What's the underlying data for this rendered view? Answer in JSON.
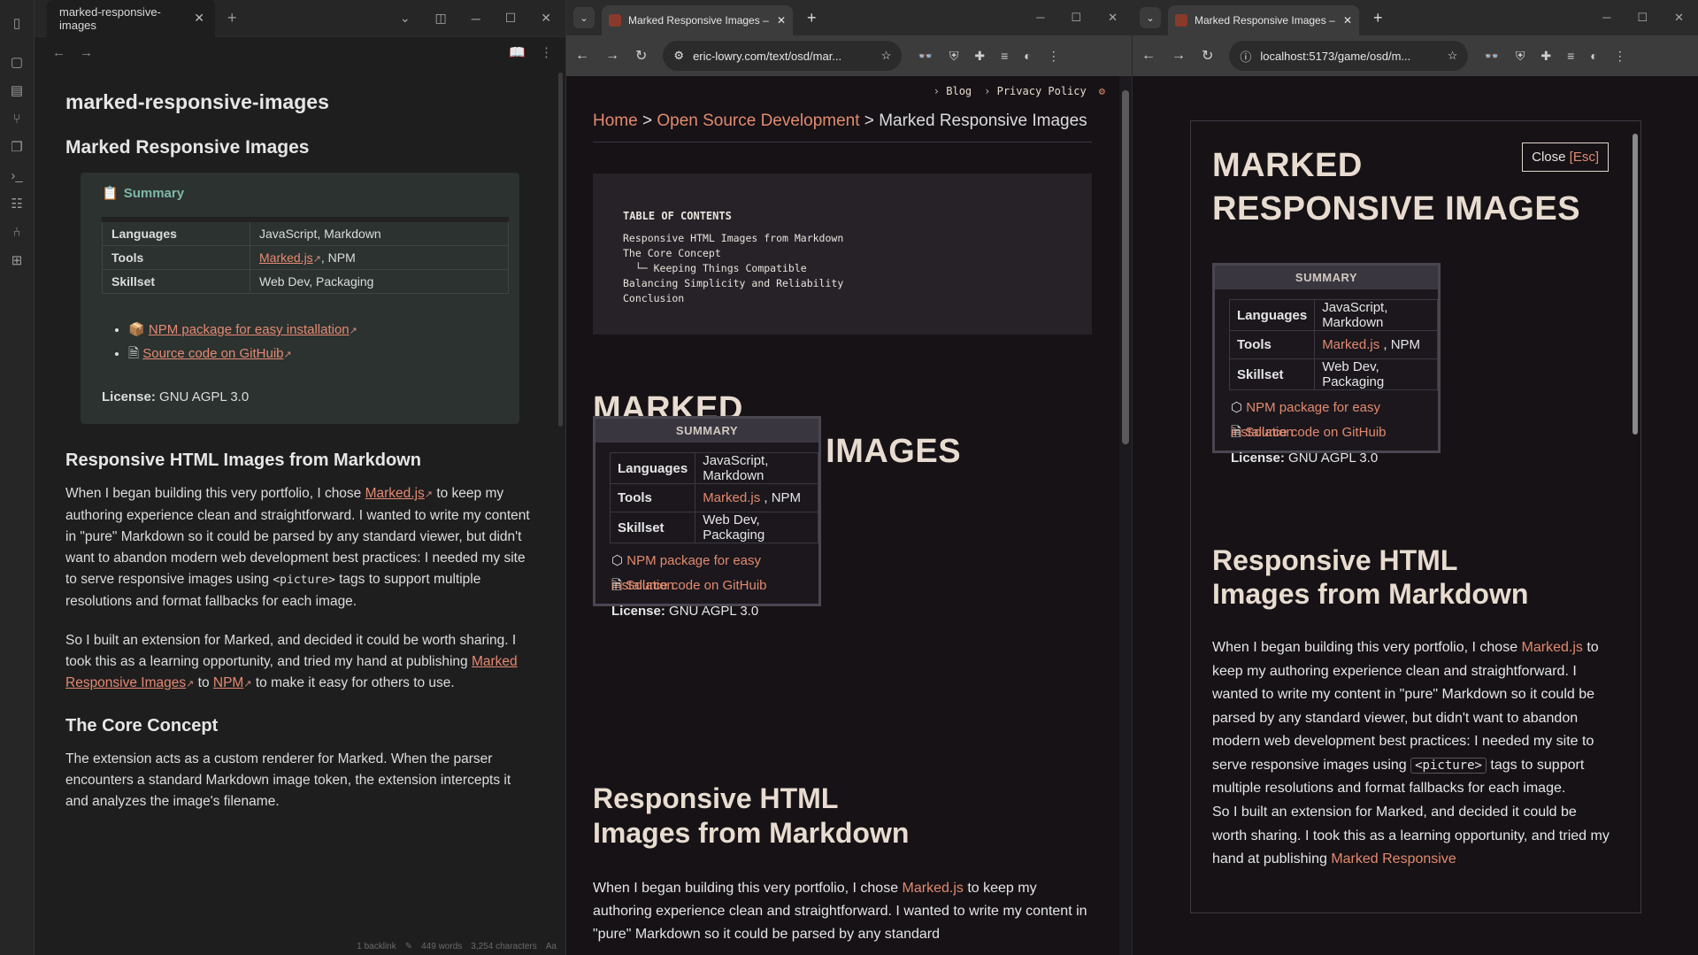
{
  "obsidian": {
    "tab_title": "marked-responsive-images",
    "note_title": "marked-responsive-images",
    "h1": "Marked Responsive Images",
    "callout_title": "Summary",
    "table": [
      {
        "k": "Languages",
        "v": "JavaScript, Markdown"
      },
      {
        "k": "Tools",
        "v_link": "Marked.js",
        "v_rest": ", NPM"
      },
      {
        "k": "Skillset",
        "v": "Web Dev, Packaging"
      }
    ],
    "list": [
      {
        "prefix": "📦 ",
        "text": "NPM package for easy installation"
      },
      {
        "prefix": "🗎 ",
        "text": "Source code on GitHuib"
      }
    ],
    "license_label": "License:",
    "license_value": " GNU AGPL 3.0",
    "h2": "Responsive HTML Images from Markdown",
    "p1_a": "When I began building this very portfolio, I chose ",
    "p1_link": "Marked.js",
    "p1_b": " to keep my authoring experience clean and straightforward. I wanted to write my content in \"pure\" Markdown so it could be parsed by any standard viewer, but didn't want to abandon modern web development best practices: I needed my site to serve responsive images using ",
    "p1_code": "<picture>",
    "p1_c": " tags to support multiple resolutions and format fallbacks for each image.",
    "p2_a": "So I built an extension for Marked, and decided it could be worth sharing. I took this as a learning opportunity, and tried my hand at publishing ",
    "p2_link1": "Marked Responsive Images",
    "p2_b": " to ",
    "p2_link2": "NPM",
    "p2_c": " to make it easy for others to use.",
    "h3": "The Core Concept",
    "p3": "The extension acts as a custom renderer for Marked. When the parser encounters a standard Markdown image token, the extension intercepts it and analyzes the image's filename.",
    "status_backlinks": "1 backlink",
    "status_words": "449 words",
    "status_chars": "3,254 characters"
  },
  "mid_browser": {
    "tab_title": "Marked Responsive Images – E",
    "url": "eric-lowry.com/text/osd/mar...",
    "topnav": [
      "Blog",
      "Privacy Policy"
    ],
    "crumb_home": "Home",
    "crumb_sep": " > ",
    "crumb_osd": "Open Source Development",
    "crumb_current": "Marked Responsive Images",
    "toc_title": "TABLE OF CONTENTS",
    "toc_items": [
      "Responsive HTML Images from Markdown",
      "The Core Concept",
      "  └─ Keeping Things Compatible",
      "Balancing Simplicity and Reliability",
      "Conclusion"
    ],
    "h1_line1": "MARKED",
    "h1_line2": "RESPONSIVE IMAGES",
    "summary_header": "SUMMARY",
    "h2_line1": "Responsive HTML",
    "h2_line2": "Images from Markdown",
    "p_a": "When I began building this very portfolio, I chose ",
    "p_link": "Marked.js",
    "p_b": "  to keep my authoring experience clean and straightforward. I wanted to write my content in \"pure\" Markdown so it could be parsed by any standard"
  },
  "right_browser": {
    "tab_title": "Marked Responsive Images – E",
    "url": "localhost:5173/game/osd/m...",
    "close_label": "Close ",
    "close_key": "[Esc]",
    "h1_line1": "MARKED",
    "h1_line2": "RESPONSIVE IMAGES",
    "summary_header": "SUMMARY",
    "h2_line1": "Responsive HTML",
    "h2_line2": "Images from Markdown",
    "p1_a": "When I began building this very portfolio, I chose ",
    "p1_link": "Marked.js",
    "p1_b": "  to keep my authoring experience clean and straightforward. I wanted to write my content in \"pure\" Markdown so it could be parsed by any standard viewer, but didn't want to abandon modern web development best practices: I needed my site to serve responsive images using ",
    "p1_code": "<picture>",
    "p1_c": " tags to support multiple resolutions and format fallbacks for each image.",
    "p2_a": "So I built an extension for Marked, and decided it could be worth sharing. I took this as a learning opportunity, and tried my hand at publishing ",
    "p2_link": "Marked Responsive"
  },
  "summary": {
    "languages_k": "Languages",
    "languages_v": "JavaScript, Markdown",
    "tools_k": "Tools",
    "tools_link": "Marked.js",
    "tools_rest": " , NPM",
    "skillset_k": "Skillset",
    "skillset_v": "Web Dev, Packaging",
    "npm_link": "NPM package for easy installation",
    "src_link": "Source code on GitHuib",
    "license_label": "License:",
    "license_value": " GNU AGPL 3.0"
  },
  "colors": {
    "accent": "#e28a6e",
    "obsidian_bg": "#1e1e1e",
    "site_bg": "#161216"
  }
}
